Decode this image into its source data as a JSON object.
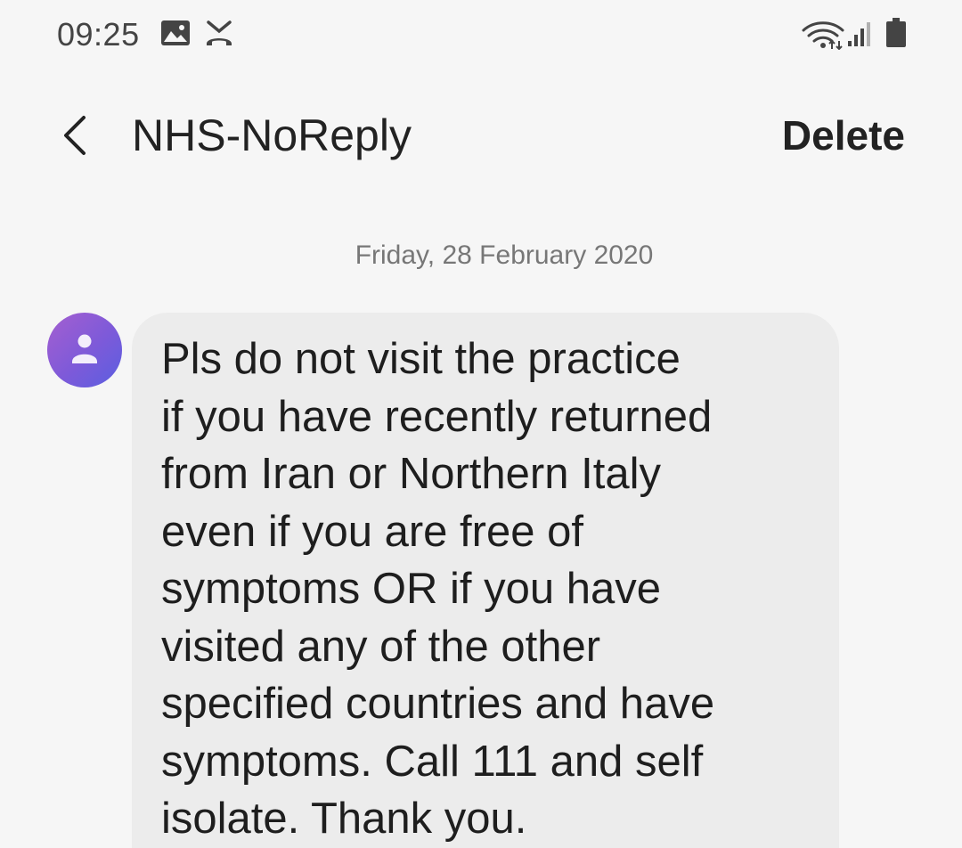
{
  "status_bar": {
    "time": "09:25",
    "left_icons": [
      "gallery-icon",
      "missed-call-icon"
    ],
    "right_icons": [
      "wifi-icon",
      "signal-icon",
      "battery-icon"
    ]
  },
  "header": {
    "back_icon": "chevron-left-icon",
    "contact_name": "NHS-NoReply",
    "delete_label": "Delete"
  },
  "conversation": {
    "date": "Friday, 28 February 2020",
    "messages": [
      {
        "avatar_icon": "person-icon",
        "text": "Pls do not visit the practice\nif you have recently returned\nfrom Iran or Northern Italy\neven if you are free of\nsymptoms OR if you have\nvisited any of the other\nspecified countries and have\nsymptoms. Call 111 and self\nisolate.  Thank you."
      }
    ]
  },
  "colors": {
    "background": "#f6f6f6",
    "bubble": "#ececec",
    "avatar_gradient_start": "#a55fd0",
    "avatar_gradient_end": "#5a5fe0"
  }
}
